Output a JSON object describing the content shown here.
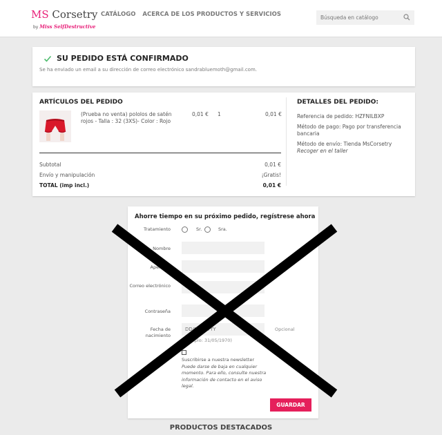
{
  "header": {
    "logo_main_prefix": "MS",
    "logo_main_rest": "Corsetry",
    "logo_by": "by",
    "logo_brand": "Miss SelfDestructive",
    "nav": [
      "Catálogo",
      "Acerca de los productos y servicios"
    ],
    "search_placeholder": "Búsqueda en catálogo",
    "search_icon": "search-icon"
  },
  "confirmation": {
    "title": "SU PEDIDO ESTÁ CONFIRMADO",
    "message": "Se ha enviado un email a su dirección de correo electrónico sandrabluemoth@gmail.com.",
    "icon": "check-icon",
    "icon_color": "#4cbb6c"
  },
  "order": {
    "heading": "ARTÍCULOS DEL PEDIDO",
    "item": {
      "name": "(Prueba no venta) pololos de satén rojos - Talla : 32 (3XS)- Color : Rojo",
      "unit_price": "0,01 €",
      "quantity": "1",
      "total": "0,01 €"
    },
    "subtotal_label": "Subtotal",
    "subtotal_value": "0,01 €",
    "shipping_label": "Envío y manipulación",
    "shipping_value": "¡Gratis!",
    "total_label": "TOTAL (imp incl.)",
    "total_value": "0,01 €"
  },
  "details": {
    "heading": "DETALLES DEL PEDIDO:",
    "reference": "Referencia de pedido: HZFNILBXP",
    "payment": "Método de pago: Pago por transferencia bancaria",
    "shipping_method": "Método de envío: Tienda MsCorsetry",
    "shipping_note": "Recoger en el taller"
  },
  "register": {
    "title": "Ahorre tiempo en su próximo pedido, regístrese ahora",
    "title_label": "Tratamiento",
    "mr": "Sr.",
    "mrs": "Sra.",
    "first_name": "Nombre",
    "last_name": "Apellidos",
    "email": "Correo electrónico",
    "password": "Contraseña",
    "birthdate": "Fecha de nacimiento",
    "birthdate_placeholder": "DD/MM/YYYY",
    "birthdate_hint": "(Ejemplo: 31/05/1970)",
    "optional": "Opcional",
    "newsletter": "Suscribirse a nuestra newsletter",
    "newsletter_note": "Puede darse de baja en cualquier momento. Para ello, consulte nuestra información de contacto en el aviso legal.",
    "save": "GUARDAR",
    "accent": "#e51f5b"
  },
  "featured": "PRODUCTOS DESTACADOS"
}
